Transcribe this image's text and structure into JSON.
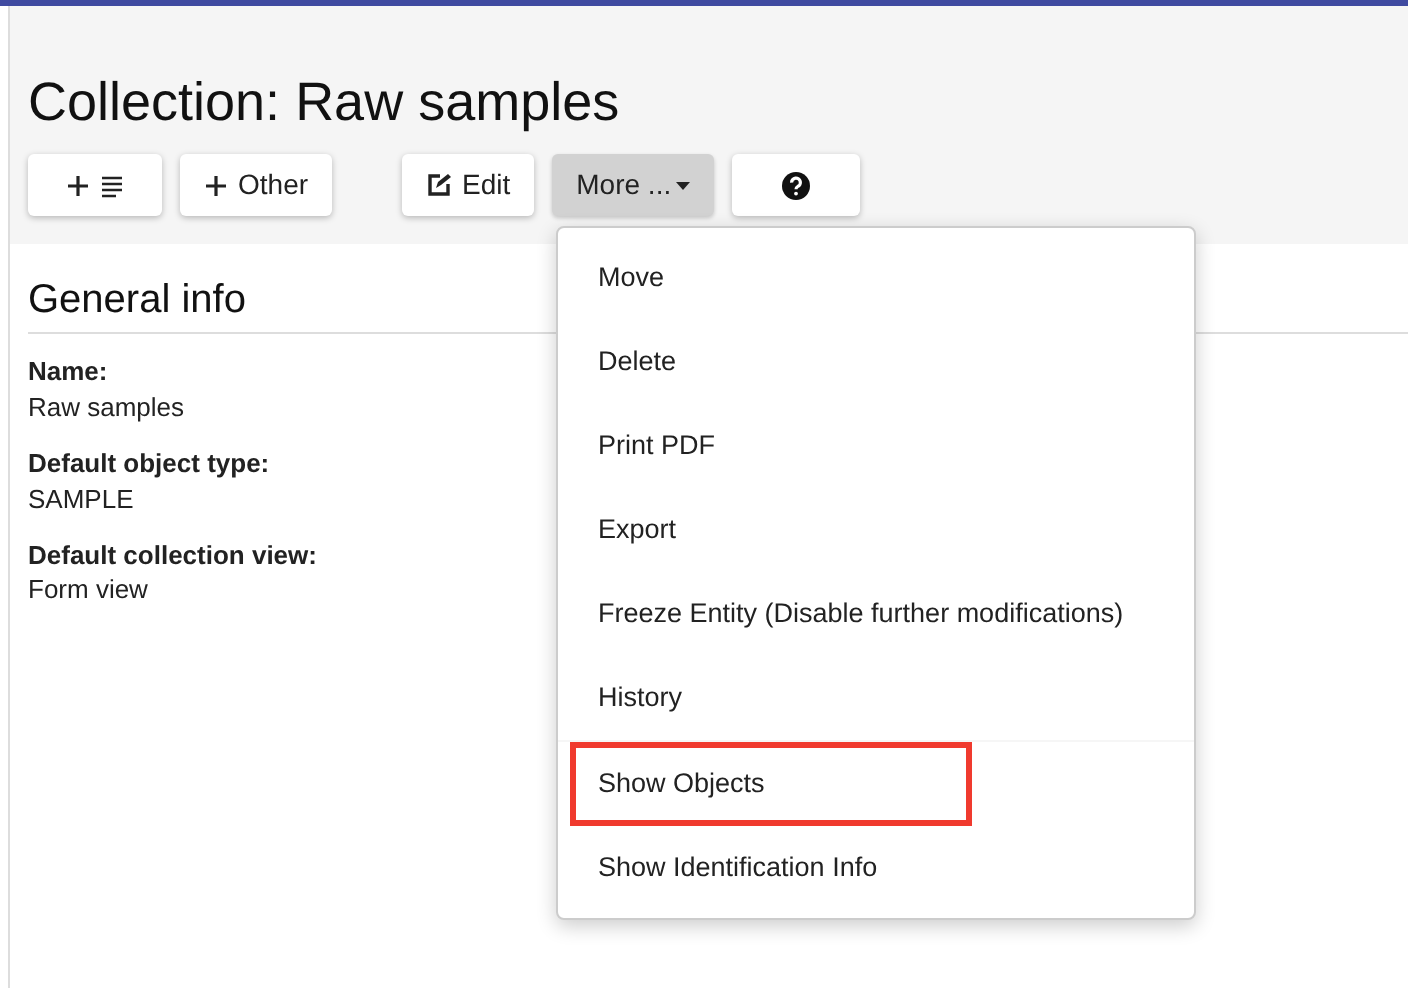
{
  "title": "Collection: Raw samples",
  "toolbar": [
    {
      "kind": "add-list",
      "pressed": false
    },
    {
      "kind": "add",
      "label": "Other",
      "pressed": false
    },
    {
      "kind": "edit",
      "label": "Edit",
      "pressed": false
    },
    {
      "kind": "dropdown",
      "label": "More ...",
      "pressed": true
    },
    {
      "kind": "help",
      "pressed": false
    }
  ],
  "section": {
    "heading": "General info",
    "fields": [
      {
        "label": "Name:",
        "value": "Raw samples"
      },
      {
        "label": "Default object type:",
        "value": "SAMPLE"
      },
      {
        "label": "Default collection view:",
        "value": "Form view"
      }
    ]
  },
  "menu": {
    "groups": [
      [
        {
          "label": "Move",
          "highlighted": false
        },
        {
          "label": "Delete",
          "highlighted": false
        },
        {
          "label": "Print PDF",
          "highlighted": false
        },
        {
          "label": "Export",
          "highlighted": false
        },
        {
          "label": "Freeze Entity (Disable further modifications)",
          "highlighted": false
        },
        {
          "label": "History",
          "highlighted": false
        }
      ],
      [
        {
          "label": "Show Objects",
          "highlighted": true
        },
        {
          "label": "Show Identification Info",
          "highlighted": false
        }
      ]
    ]
  }
}
